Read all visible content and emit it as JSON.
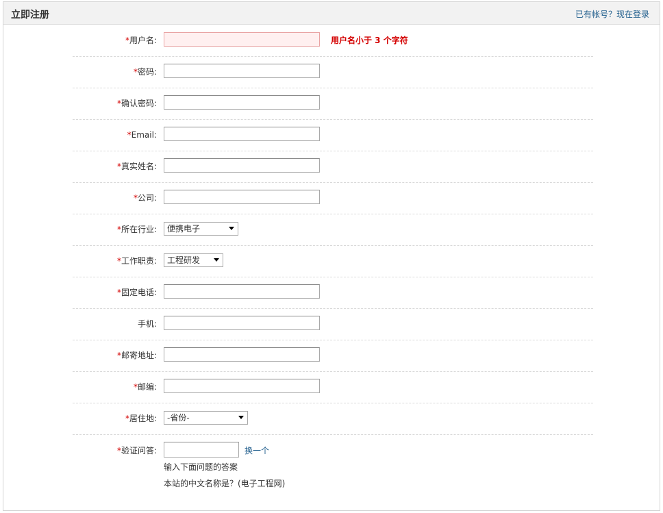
{
  "header": {
    "title": "立即注册",
    "login_link": "已有帐号？现在登录"
  },
  "required_mark": "*",
  "fields": {
    "username": {
      "label": "用户名:",
      "error": "用户名小于  3 个字符"
    },
    "password": {
      "label": "密码:"
    },
    "confirm_password": {
      "label": "确认密码:"
    },
    "email": {
      "label": "Email:"
    },
    "real_name": {
      "label": "真实姓名:"
    },
    "company": {
      "label": "公司:"
    },
    "industry": {
      "label": "所在行业:",
      "selected": "便携电子"
    },
    "job_role": {
      "label": "工作职责:",
      "selected": "工程研发"
    },
    "landline": {
      "label": "固定电话:"
    },
    "mobile": {
      "label": "手机:"
    },
    "address": {
      "label": "邮寄地址:"
    },
    "zipcode": {
      "label": "邮编:"
    },
    "residence": {
      "label": "居住地:",
      "selected": "-省份-"
    },
    "verification": {
      "label": "验证问答:",
      "refresh": "换一个",
      "hint": "输入下面问题的答案",
      "question": "本站的中文名称是？(电子工程网)"
    }
  },
  "colors": {
    "required": "#d40000",
    "link": "#1f5d8c",
    "error_bg": "#fff0f0"
  }
}
